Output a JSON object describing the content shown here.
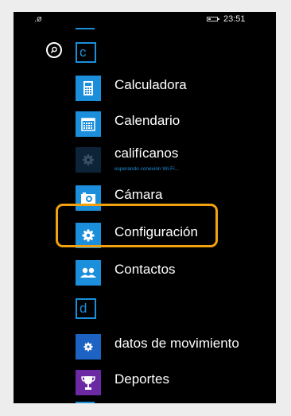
{
  "status_bar": {
    "time": "23:51",
    "signal_text": ".ø"
  },
  "search": {
    "icon": "search-icon"
  },
  "groups": [
    {
      "letter": "c"
    },
    {
      "letter": "d"
    }
  ],
  "apps": [
    {
      "name": "Calculadora",
      "icon": "calculator-icon"
    },
    {
      "name": "Calendario",
      "icon": "calendar-icon"
    },
    {
      "name": "califícanos",
      "subtitle": "esperando conexión Wi-Fi...",
      "icon": "gear-icon"
    },
    {
      "name": "Cámara",
      "icon": "camera-icon"
    },
    {
      "name": "Configuración",
      "icon": "gear-icon",
      "highlighted": true
    },
    {
      "name": "Contactos",
      "icon": "people-icon"
    },
    {
      "name": "datos de movimiento",
      "icon": "gear-icon"
    },
    {
      "name": "Deportes",
      "icon": "trophy-icon"
    }
  ],
  "colors": {
    "accent": "#1b8fdb",
    "sports_tile": "#6b2aa3",
    "dim_tile": "#0d2338",
    "highlight": "#f2a20f",
    "background": "#000000"
  }
}
